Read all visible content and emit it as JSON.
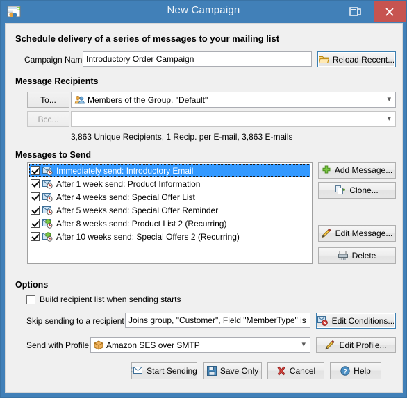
{
  "window": {
    "title": "New Campaign",
    "app_icon": "campaign-window-icon",
    "help_icon": "context-help-icon",
    "close_label": "×",
    "accent_color": "#4180b8",
    "close_color": "#c75450",
    "selection_color": "#3399ff",
    "body_color": "#f0f0f0"
  },
  "heading": "Schedule delivery of a series of messages to your mailing list",
  "campaign": {
    "name_label": "Campaign Name:",
    "name_value": "Introductory Order Campaign",
    "name_placeholder": "",
    "reload_label": "Reload Recent...",
    "reload_icon": "open-folder-icon"
  },
  "recipients": {
    "group_title": "Message Recipients",
    "to_button": "To...",
    "to_value": "Members of the Group, \"Default\"",
    "to_icon": "group-users-icon",
    "bcc_button": "Bcc...",
    "bcc_value": "",
    "summary": "3,863 Unique Recipients,  1 Recip. per E-mail,  3,863 E-mails"
  },
  "messages": {
    "group_title": "Messages to Send",
    "items": [
      {
        "checked": true,
        "label": "Immediately send: Introductory Email",
        "icon": "scheduled-email-icon",
        "selected": true
      },
      {
        "checked": true,
        "label": "After  1 week send: Product Information",
        "icon": "scheduled-email-icon",
        "selected": false
      },
      {
        "checked": true,
        "label": "After 4 weeks send: Special Offer List",
        "icon": "scheduled-email-icon",
        "selected": false
      },
      {
        "checked": true,
        "label": "After 5 weeks send: Special Offer Reminder",
        "icon": "scheduled-email-icon",
        "selected": false
      },
      {
        "checked": true,
        "label": "After 8 weeks send: Product List 2 (Recurring)",
        "icon": "recurring-email-icon",
        "selected": false
      },
      {
        "checked": true,
        "label": "After  10 weeks send: Special Offers 2 (Recurring)",
        "icon": "recurring-email-icon",
        "selected": false
      }
    ],
    "buttons": {
      "add": "Add Message...",
      "add_icon": "green-plus-icon",
      "clone": "Clone...",
      "clone_icon": "copy-pages-icon",
      "edit": "Edit Message...",
      "edit_icon": "pencil-icon",
      "delete": "Delete",
      "delete_icon": "shredder-icon"
    }
  },
  "options": {
    "group_title": "Options",
    "build_list_label": "Build recipient list when sending starts",
    "build_list_checked": false,
    "skip_label": "Skip sending to a recipient if:",
    "skip_value": "Joins group, \"Customer\", Field \"MemberType\" is \"CUSTO",
    "edit_conditions_label": "Edit Conditions...",
    "edit_conditions_icon": "conditions-deny-icon",
    "profile_label": "Send with Profile:",
    "profile_value": "Amazon SES over SMTP",
    "profile_icon": "package-box-icon",
    "edit_profile_label": "Edit Profile...",
    "edit_profile_icon": "pencil-icon"
  },
  "footer": {
    "start_label": "Start Sending",
    "start_icon": "send-email-icon",
    "save_label": "Save Only",
    "save_icon": "floppy-disk-icon",
    "cancel_label": "Cancel",
    "cancel_icon": "red-x-icon",
    "help_label": "Help",
    "help_icon": "question-circle-icon"
  }
}
